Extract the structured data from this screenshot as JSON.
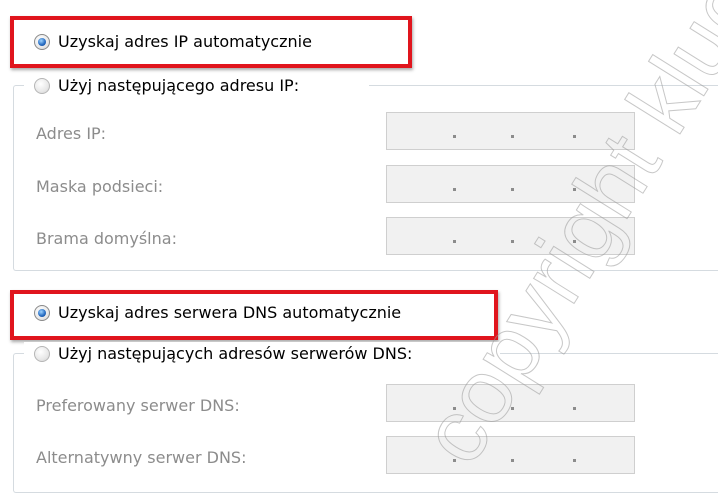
{
  "ip_section": {
    "auto_option": {
      "label": "Uzyskaj adres IP automatycznie",
      "checked": true
    },
    "manual_option": {
      "label": "Użyj następującego adresu IP:",
      "checked": false
    },
    "fields": [
      {
        "label": "Adres IP:",
        "value": " .   .   ."
      },
      {
        "label": "Maska podsieci:",
        "value": " .   .   ."
      },
      {
        "label": "Brama domyślna:",
        "value": " .   .   ."
      }
    ]
  },
  "dns_section": {
    "auto_option": {
      "label": "Uzyskaj adres serwera DNS automatycznie",
      "checked": true
    },
    "manual_option": {
      "label": "Użyj następujących adresów serwerów DNS:",
      "checked": false
    },
    "fields": [
      {
        "label": "Preferowany serwer DNS:",
        "value": " .   .   ."
      },
      {
        "label": "Alternatywny serwer DNS:",
        "value": " .   .   ."
      }
    ]
  },
  "watermark": {
    "text": "copyright klucz"
  },
  "colors": {
    "highlight": "#e0151d",
    "disabled_text": "#8c8c8c",
    "field_bg": "#f1f1f1",
    "group_border": "#d5dbe0"
  }
}
